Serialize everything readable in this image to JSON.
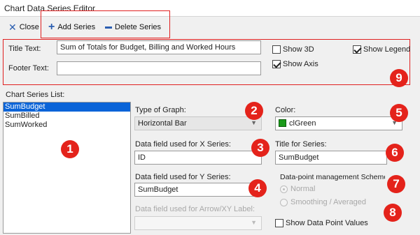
{
  "window": {
    "title": "Chart Data Series Editor"
  },
  "toolbar": {
    "close_label": "Close",
    "add_label": "Add Series",
    "delete_label": "Delete Series"
  },
  "header": {
    "title_label": "Title Text:",
    "title_value": "Sum of Totals for Budget, Billing and Worked Hours",
    "footer_label": "Footer Text:",
    "footer_value": "",
    "show3d_label": "Show 3D",
    "show3d_checked": false,
    "showlegend_label": "Show Legend",
    "showlegend_checked": true,
    "showaxis_label": "Show Axis",
    "showaxis_checked": true
  },
  "series_list": {
    "label": "Chart Series List:",
    "items": [
      "SumBudget",
      "SumBilled",
      "SumWorked"
    ],
    "selected_index": 0
  },
  "graph_type": {
    "label": "Type of Graph:",
    "value": "Horizontal Bar"
  },
  "x_field": {
    "label": "Data field used for X Series:",
    "value": "ID"
  },
  "y_field": {
    "label": "Data field used for Y Series:",
    "value": "SumBudget"
  },
  "arrow_field": {
    "label": "Data field used for Arrow/XY Label:",
    "value": ""
  },
  "color": {
    "label": "Color:",
    "value": "clGreen",
    "swatch": "#1a9a1a"
  },
  "series_title": {
    "label": "Title for Series:",
    "value": "SumBudget"
  },
  "datapoint": {
    "label": "Data-point management Scheme",
    "options": [
      "Normal",
      "Smoothing / Averaged"
    ],
    "selected_index": 0
  },
  "show_values": {
    "label": "Show Data Point Values",
    "checked": false
  },
  "badges": [
    "1",
    "2",
    "3",
    "4",
    "5",
    "6",
    "7",
    "8",
    "9"
  ],
  "colors": {
    "accent": "#2a5db0",
    "selection": "#0a64d8",
    "annotation": "#e4231b"
  }
}
